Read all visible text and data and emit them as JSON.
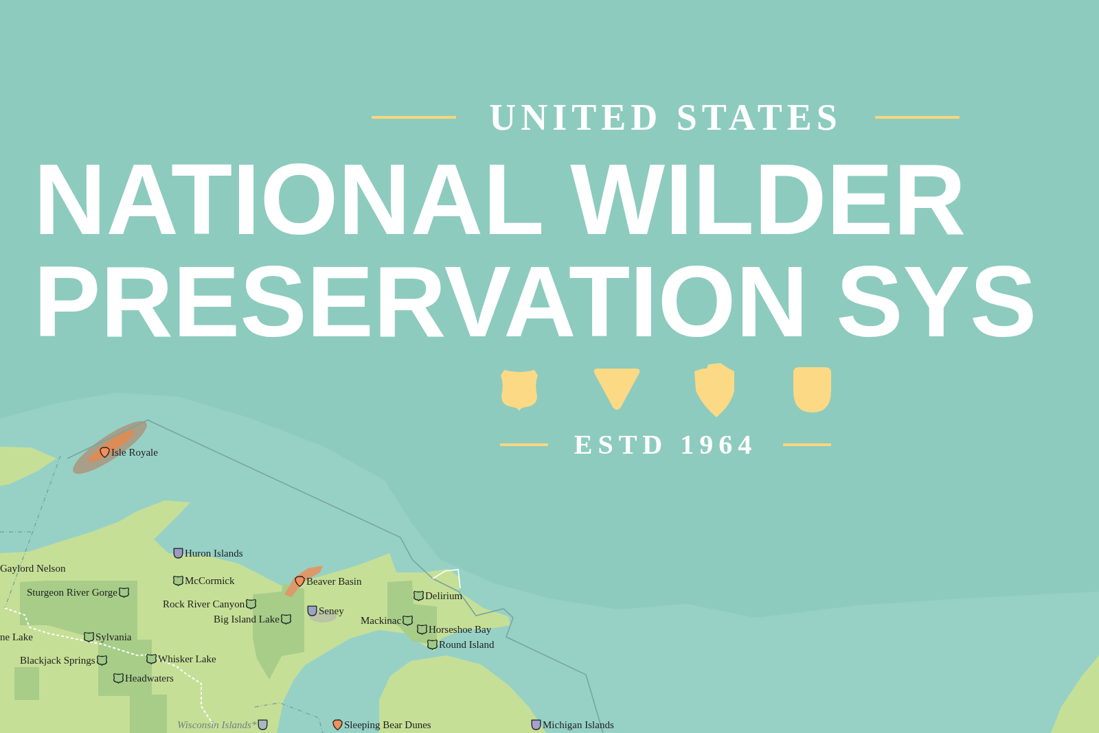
{
  "header": {
    "subtitle": "UNITED STATES",
    "title_lines": [
      "NATIONAL WILDER",
      "PRESERVATION SYS"
    ],
    "established": "ESTD 1964"
  },
  "markers": [
    {
      "name": "Isle Royale",
      "kind": "park",
      "color": "#f0905e",
      "faded": false
    },
    {
      "name": "Huron Islands",
      "kind": "refuge",
      "color": "#9d9ac0",
      "faded": false
    },
    {
      "name": "Gaylord Nelson",
      "kind": "text",
      "faded": false
    },
    {
      "name": "McCormick",
      "kind": "forest",
      "color": "#9fca88",
      "faded": false
    },
    {
      "name": "Beaver Basin",
      "kind": "park",
      "color": "#f0905e",
      "faded": false
    },
    {
      "name": "Sturgeon River Gorge",
      "kind": "forest",
      "color": "#9fca88",
      "faded": false
    },
    {
      "name": "Delirium",
      "kind": "forest",
      "color": "#9fca88",
      "faded": false
    },
    {
      "name": "Rock River Canyon",
      "kind": "forest",
      "color": "#9fca88",
      "faded": false
    },
    {
      "name": "Seney",
      "kind": "refuge",
      "color": "#9aa4c4",
      "faded": false
    },
    {
      "name": "Big Island Lake",
      "kind": "forest",
      "color": "#9fca88",
      "faded": false
    },
    {
      "name": "Mackinac",
      "kind": "forest",
      "color": "#9fca88",
      "faded": false
    },
    {
      "name": "Horseshoe Bay",
      "kind": "forest",
      "color": "#9fca88",
      "faded": false
    },
    {
      "name": "ne Lake",
      "kind": "text",
      "faded": false
    },
    {
      "name": "Sylvania",
      "kind": "forest",
      "color": "#9fca88",
      "faded": false
    },
    {
      "name": "Round Island",
      "kind": "forest",
      "color": "#9fca88",
      "faded": false
    },
    {
      "name": "Whisker Lake",
      "kind": "forest",
      "color": "#9fca88",
      "faded": false
    },
    {
      "name": "Blackjack Springs",
      "kind": "forest",
      "color": "#9fca88",
      "faded": false
    },
    {
      "name": "Headwaters",
      "kind": "forest",
      "color": "#9fca88",
      "faded": false
    },
    {
      "name": "Wisconsin Islands*",
      "kind": "refuge",
      "color": "#a9b8c0",
      "faded": true
    },
    {
      "name": "Sleeping Bear Dunes",
      "kind": "park",
      "color": "#f0905e",
      "faded": false
    },
    {
      "name": "Michigan Islands",
      "kind": "refuge",
      "color": "#a79fd1",
      "faded": false
    }
  ]
}
